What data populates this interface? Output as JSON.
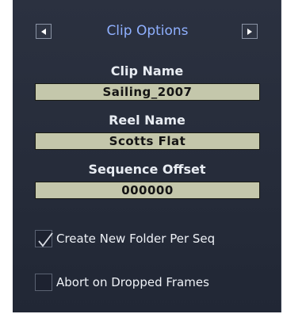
{
  "header": {
    "title": "Clip Options",
    "prev_icon": "triangle-left-icon",
    "next_icon": "triangle-right-icon"
  },
  "fields": {
    "clip_name": {
      "label": "Clip Name",
      "value": "Sailing_2007"
    },
    "reel_name": {
      "label": "Reel Name",
      "value": "Scotts Flat"
    },
    "sequence_offset": {
      "label": "Sequence Offset",
      "value": "000000"
    }
  },
  "options": {
    "create_folder": {
      "label": "Create New Folder Per Seq",
      "checked": true
    },
    "abort_dropped": {
      "label": "Abort on Dropped Frames",
      "checked": false
    }
  },
  "colors": {
    "panel_bg": "#262c3a",
    "title": "#8fb0ff",
    "field_bg": "#c4c7ab",
    "label_text": "#e8ecf2"
  }
}
